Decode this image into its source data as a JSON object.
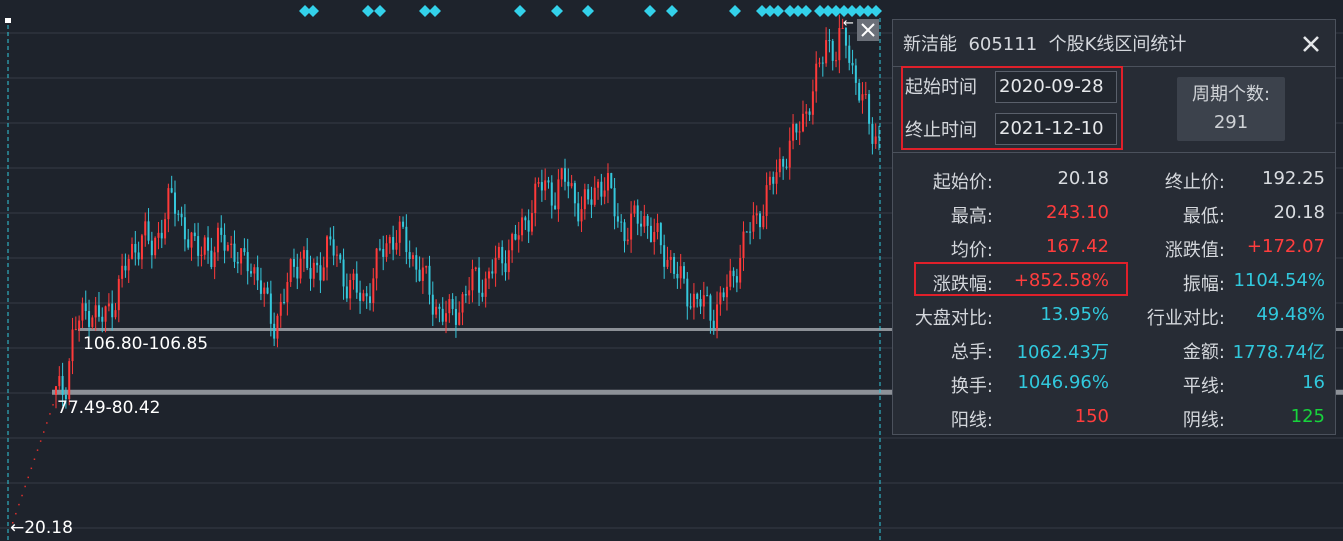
{
  "chart_data": {
    "type": "candlestick",
    "y_scale": {
      "min": 20.18,
      "max": 243.1
    },
    "levels": [
      {
        "label": "106.80-106.85",
        "low": 106.8,
        "high": 106.85
      },
      {
        "label": "77.49-80.42",
        "low": 77.49,
        "high": 80.42
      }
    ],
    "start_label": "←20.18",
    "top_marker": "←",
    "approx_closes": [
      20.18,
      77.49,
      80.42,
      106.85,
      112,
      118,
      110,
      115,
      125,
      135,
      145,
      150,
      142,
      155,
      165,
      160,
      150,
      140,
      148,
      138,
      150,
      145,
      135,
      140,
      130,
      118,
      110,
      120,
      135,
      142,
      130,
      135,
      145,
      140,
      130,
      125,
      120,
      128,
      140,
      148,
      150,
      145,
      138,
      130,
      120,
      115,
      112,
      118,
      125,
      130,
      128,
      135,
      140,
      145,
      150,
      160,
      170,
      172,
      168,
      175,
      170,
      160,
      165,
      175,
      170,
      160,
      150,
      155,
      160,
      150,
      145,
      140,
      130,
      125,
      120,
      118,
      115,
      120,
      128,
      140,
      150,
      158,
      165,
      175,
      185,
      190,
      200,
      210,
      220,
      240,
      230,
      243.1,
      225,
      210,
      200,
      192.25
    ],
    "diamond_count": 36
  },
  "panel": {
    "stock_name": "新洁能",
    "stock_code": "605111",
    "title_suffix": "个股K线区间统计",
    "start_label": "起始时间",
    "start_date": "2020-09-28",
    "end_label": "终止时间",
    "end_date": "2021-12-10",
    "cycle_label": "周期个数:",
    "cycle_value": "291",
    "stats": {
      "open_label": "起始价:",
      "open_value": "20.18",
      "close_label": "终止价:",
      "close_value": "192.25",
      "high_label": "最高:",
      "high_value": "243.10",
      "low_label": "最低:",
      "low_value": "20.18",
      "avg_label": "均价:",
      "avg_value": "167.42",
      "chg_label": "涨跌值:",
      "chg_value": "+172.07",
      "pct_label": "涨跌幅:",
      "pct_value": "+852.58%",
      "amp_label": "振幅:",
      "amp_value": "1104.54%",
      "mkt_label": "大盘对比:",
      "mkt_value": "13.95%",
      "ind_label": "行业对比:",
      "ind_value": "49.48%",
      "vol_label": "总手:",
      "vol_value": "1062.43万",
      "amt_label": "金额:",
      "amt_value": "1778.74亿",
      "turn_label": "换手:",
      "turn_value": "1046.96%",
      "flat_label": "平线:",
      "flat_value": "16",
      "up_label": "阳线:",
      "up_value": "150",
      "down_label": "阴线:",
      "down_value": "125"
    },
    "colors": {
      "red": "#ff3d3d",
      "cyan": "#31c8dc",
      "green": "#17d43c"
    }
  }
}
